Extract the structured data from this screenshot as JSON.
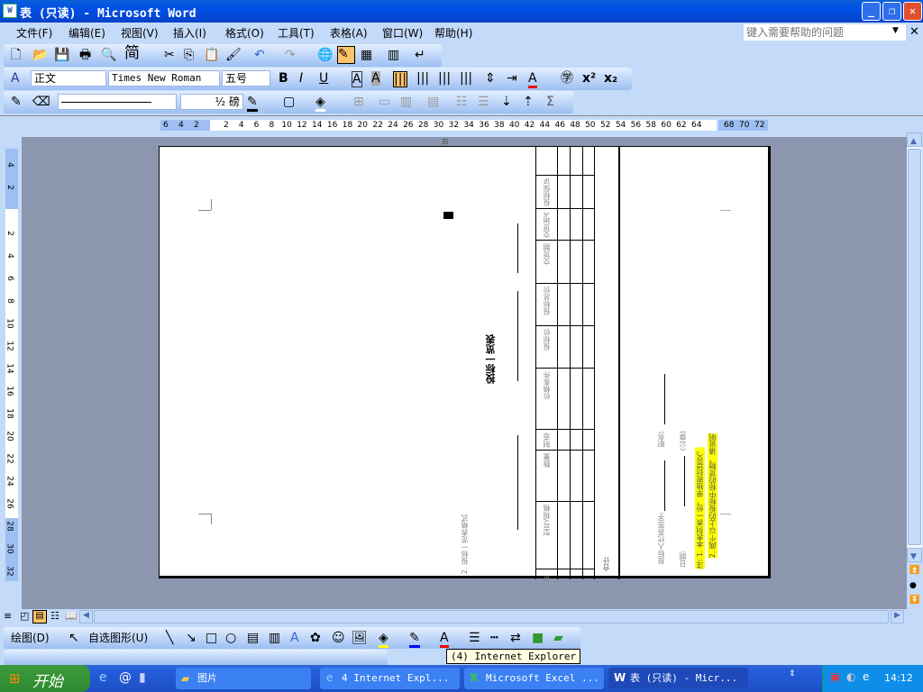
{
  "window": {
    "title": "表 (只读) - Microsoft Word",
    "app_icon": "word-icon",
    "controls": [
      "minimize",
      "restore",
      "close"
    ]
  },
  "menu": [
    "文件(F)",
    "编辑(E)",
    "视图(V)",
    "插入(I)",
    "格式(O)",
    "工具(T)",
    "表格(A)",
    "窗口(W)",
    "帮助(H)"
  ],
  "help_box": {
    "placeholder": "键入需要帮助的问题"
  },
  "toolbar_standard": {
    "simplified_label": "简"
  },
  "toolbar_format": {
    "style": "正文",
    "font": "Times New Roman",
    "size": "五号"
  },
  "toolbar_tables": {
    "line_weight": "½ 磅"
  },
  "ruler_h": {
    "left": [
      "6",
      "4",
      "2"
    ],
    "main": [
      "2",
      "4",
      "6",
      "8",
      "10",
      "12",
      "14",
      "16",
      "18",
      "20",
      "22",
      "24",
      "26",
      "28",
      "30",
      "32",
      "34",
      "36",
      "38",
      "40",
      "42",
      "44",
      "46",
      "48",
      "50",
      "52",
      "54",
      "56",
      "58",
      "60",
      "62",
      "64"
    ],
    "right": [
      "68",
      "70",
      "72"
    ]
  },
  "ruler_v": {
    "top": [
      "4",
      "2"
    ],
    "main": [
      "2",
      "4",
      "6",
      "8",
      "10",
      "12",
      "14",
      "16",
      "18",
      "20",
      "22",
      "24",
      "26",
      "28",
      "30",
      "32"
    ]
  },
  "document": {
    "title": "投标一览表",
    "footer_left": "2. 投标一览表格式",
    "table_headers": [
      "货物名称",
      "型号/规格",
      "数量",
      "制造商名称",
      "价格条件",
      "投标价",
      "投标总价",
      "交货期",
      "交货地点",
      "投标保证金"
    ],
    "total_label": "合计",
    "signature": "投标人代表签字:",
    "position": "职务:",
    "date": "日期:",
    "seal": "(公章)",
    "note1": "注: 1. 本表列表一份，单独密封提交。",
    "note2": "2. 两个以上的投标中标的货物，请说明"
  },
  "drawing_toolbar": {
    "draw": "绘图(D)",
    "autoshapes": "自选图形(U)"
  },
  "tooltip": "(4) Internet Explorer",
  "taskbar": {
    "start": "开始",
    "buttons": [
      "图片",
      "4 Internet Expl...",
      "Microsoft Excel ...",
      "表 (只读) - Micr..."
    ],
    "clock": "14:12"
  }
}
